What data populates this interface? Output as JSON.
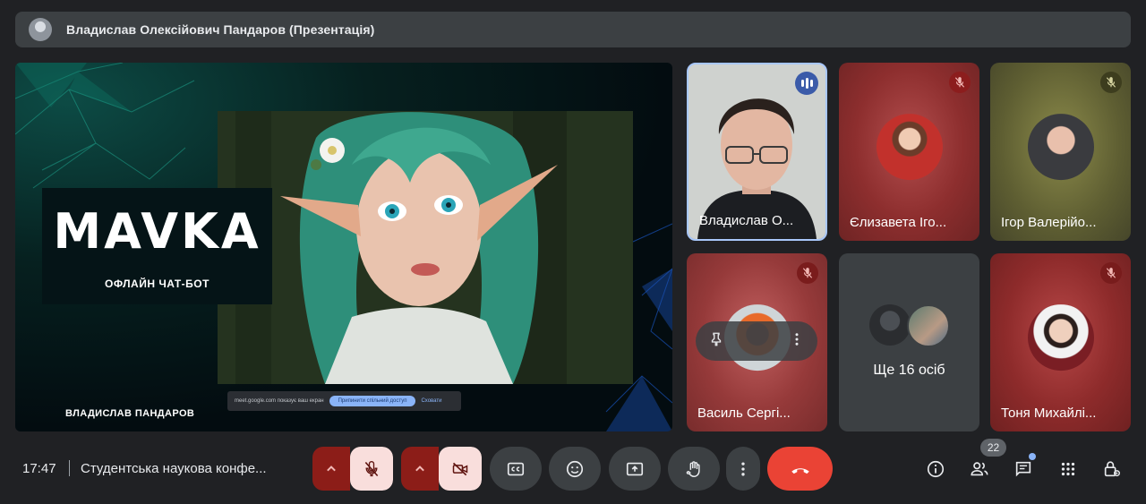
{
  "presenter_bar": {
    "title": "Владислав Олексійович Пандаров (Презентація)"
  },
  "slide": {
    "logo": "MAVKA",
    "subtitle": "ОФЛАЙН ЧАТ-БОТ",
    "author": "ВЛАДИСЛАВ ПАНДАРОВ",
    "share_bar": {
      "text": "meet.google.com показує ваш екран",
      "stop_label": "Припинити спільний доступ",
      "hide_label": "Сховати"
    }
  },
  "participants": [
    {
      "name": "Владислав О...",
      "speaking": true
    },
    {
      "name": "Єлизавета Іго...",
      "muted": true
    },
    {
      "name": "Ігор Валерійо...",
      "muted": true
    },
    {
      "name": "Василь Сергі...",
      "muted": true
    },
    {
      "more_label": "Ще 16 осіб"
    },
    {
      "name": "Тоня Михайлі...",
      "muted": true
    }
  ],
  "footer": {
    "time": "17:47",
    "meeting_title": "Студентська наукова конфе...",
    "people_count": "22"
  },
  "icons": {
    "mic": "mic-off-icon",
    "camera": "videocam-off-icon",
    "captions": "closed-caption-icon",
    "emoji": "emoji-icon",
    "present": "present-screen-icon",
    "hand": "raise-hand-icon",
    "more": "more-vert-icon",
    "end": "call-end-icon",
    "info": "info-icon",
    "people": "people-icon",
    "chat": "chat-icon",
    "apps": "apps-icon",
    "host": "host-controls-icon"
  },
  "colors": {
    "background": "#202124",
    "control": "#3c4043",
    "danger": "#ea4335",
    "muted_control_bg": "#f9dedc",
    "accent": "#a8c7fa"
  }
}
